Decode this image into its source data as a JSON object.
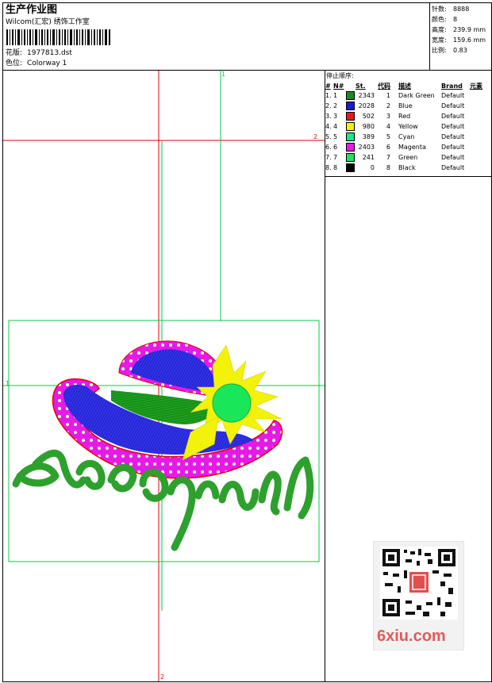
{
  "header": {
    "title": "生产作业图",
    "subtitle": "Wilcom(汇宏) 绣饰工作室",
    "pattern_label": "花版:",
    "pattern_value": "1977813.dst",
    "color_label": "色位:",
    "color_value": "Colorway 1"
  },
  "stats": {
    "stitches_label": "针数:",
    "stitches_value": "8888",
    "colors_label": "颜色:",
    "colors_value": "8",
    "height_label": "高度:",
    "height_value": "239.9 mm",
    "width_label": "宽度:",
    "width_value": "159.6 mm",
    "scale_label": "比例:",
    "scale_value": "0.83"
  },
  "stop_sequence": {
    "title": "停止顺序:",
    "headers": [
      "#",
      "N#",
      "St.",
      "代码",
      "描述",
      "Brand",
      "元素"
    ],
    "rows": [
      {
        "n": "1.",
        "nn": "1",
        "color": "#1a8c1a",
        "st": "2343",
        "code": "1",
        "desc": "Dark Green",
        "brand": "Default"
      },
      {
        "n": "2.",
        "nn": "2",
        "color": "#1a1ad6",
        "st": "2028",
        "code": "2",
        "desc": "Blue",
        "brand": "Default"
      },
      {
        "n": "3.",
        "nn": "3",
        "color": "#e61a1a",
        "st": "502",
        "code": "3",
        "desc": "Red",
        "brand": "Default"
      },
      {
        "n": "4.",
        "nn": "4",
        "color": "#f2f20a",
        "st": "980",
        "code": "4",
        "desc": "Yellow",
        "brand": "Default"
      },
      {
        "n": "5.",
        "nn": "5",
        "color": "#1ae68c",
        "st": "389",
        "code": "5",
        "desc": "Cyan",
        "brand": "Default"
      },
      {
        "n": "6.",
        "nn": "6",
        "color": "#e61ae6",
        "st": "2403",
        "code": "6",
        "desc": "Magenta",
        "brand": "Default"
      },
      {
        "n": "7.",
        "nn": "7",
        "color": "#1ae65a",
        "st": "241",
        "code": "7",
        "desc": "Green",
        "brand": "Default"
      },
      {
        "n": "8.",
        "nn": "8",
        "color": "#000000",
        "st": "0",
        "code": "8",
        "desc": "Black",
        "brand": "Default"
      }
    ]
  },
  "guides": {
    "label_top": "1",
    "label_left": "1",
    "label_right": "2",
    "label_bottom": "2"
  },
  "watermark": {
    "text": "6xiu.com"
  },
  "colors": {
    "guide_red": "#e60000",
    "guide_green": "#00cc44"
  }
}
